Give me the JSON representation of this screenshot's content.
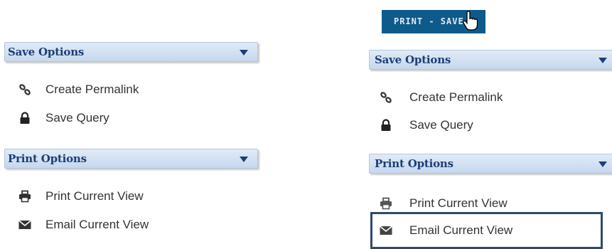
{
  "left": {
    "save_options": {
      "title": "Save Options",
      "items": [
        {
          "label": "Create Permalink",
          "icon": "link-icon"
        },
        {
          "label": "Save Query",
          "icon": "lock-icon"
        }
      ]
    },
    "print_options": {
      "title": "Print Options",
      "items": [
        {
          "label": "Print Current View",
          "icon": "printer-icon"
        },
        {
          "label": "Email Current View",
          "icon": "envelope-icon"
        }
      ]
    }
  },
  "right": {
    "print_save_button": {
      "label": "PRINT - SAVE"
    },
    "save_options": {
      "title": "Save Options",
      "items": [
        {
          "label": "Create Permalink",
          "icon": "link-icon"
        },
        {
          "label": "Save Query",
          "icon": "lock-icon"
        }
      ]
    },
    "print_options": {
      "title": "Print Options",
      "items": [
        {
          "label": "Print Current View",
          "icon": "printer-icon"
        },
        {
          "label": "Email Current View",
          "icon": "envelope-icon"
        }
      ]
    }
  },
  "colors": {
    "header_gradient_top": "#e1ebf7",
    "header_gradient_bottom": "#c6d7ee",
    "header_text": "#1c3f73",
    "button_bg": "#0e5a8a",
    "highlight_border": "#2d4a6d"
  }
}
